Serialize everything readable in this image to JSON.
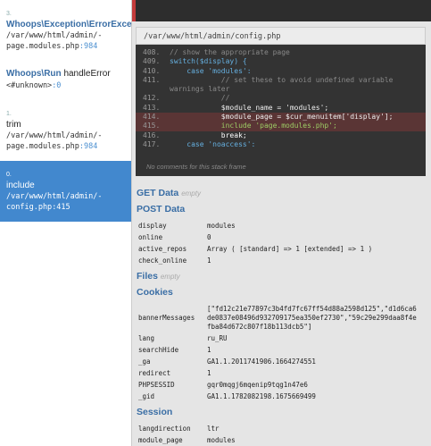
{
  "frames": [
    {
      "num": "3.",
      "class": "Whoops\\Exception\\ErrorException",
      "function": "",
      "path": "/var/www/html/admin/-page.modules.php",
      "line": ":984"
    },
    {
      "num": "",
      "class": "Whoops\\Run",
      "function": "handleError",
      "path": "<#unknown>",
      "line": ":0"
    },
    {
      "num": "1.",
      "class": "",
      "function": "trim",
      "path": "/var/www/html/admin/-page.modules.php",
      "line": ":984"
    },
    {
      "num": "0.",
      "class": "",
      "function": "include",
      "path": "/var/www/html/admin/-config.php",
      "line": ":415"
    }
  ],
  "code": {
    "file_path": "/var/www/html/admin/config.php",
    "lines": [
      {
        "n": "408.",
        "text": "// show the appropriate page"
      },
      {
        "n": "409.",
        "text": "switch($display) {"
      },
      {
        "n": "410.",
        "text": "    case 'modules':"
      },
      {
        "n": "411.",
        "text": "            // set these to avoid undefined variable warnings later"
      },
      {
        "n": "412.",
        "text": "            //"
      },
      {
        "n": "413.",
        "text": "            $module_name = 'modules';"
      },
      {
        "n": "414.",
        "text": "            $module_page = $cur_menuitem['display'];"
      },
      {
        "n": "415.",
        "text": "            include 'page.modules.php';"
      },
      {
        "n": "416.",
        "text": "            break;"
      },
      {
        "n": "417.",
        "text": "    case 'noaccess':"
      }
    ],
    "no_comments": "No comments for this stack frame"
  },
  "sections": {
    "get": {
      "title": "GET Data",
      "empty": "empty"
    },
    "post": {
      "title": "POST Data",
      "rows": [
        {
          "k": "display",
          "v": "modules"
        },
        {
          "k": "online",
          "v": "0"
        },
        {
          "k": "active_repos",
          "v": "Array ( [standard] => 1 [extended] => 1 )"
        },
        {
          "k": "check_online",
          "v": "1"
        }
      ]
    },
    "files": {
      "title": "Files",
      "empty": "empty"
    },
    "cookies": {
      "title": "Cookies",
      "rows": [
        {
          "k": "bannerMessages",
          "v": "[\"fd12c21e77897c3b4fd7fc67ff54d88a2598d125\",\"d1d6ca6de0837e08496d932709175ea350ef2730\",\"59c29e299daa8f4efba84d672c807f18b113dcb5\"]"
        },
        {
          "k": "lang",
          "v": "ru_RU"
        },
        {
          "k": "searchHide",
          "v": "1"
        },
        {
          "k": "_ga",
          "v": "GA1.1.2011741906.1664274551"
        },
        {
          "k": "redirect",
          "v": "1"
        },
        {
          "k": "PHPSESSID",
          "v": "gqr0mqgj6mqenip9tqg1n47e6"
        },
        {
          "k": "_gid",
          "v": "GA1.1.1782082198.1675669499"
        }
      ]
    },
    "session": {
      "title": "Session",
      "rows": [
        {
          "k": "langdirection",
          "v": "ltr"
        },
        {
          "k": "module_page",
          "v": "modules"
        }
      ]
    }
  }
}
